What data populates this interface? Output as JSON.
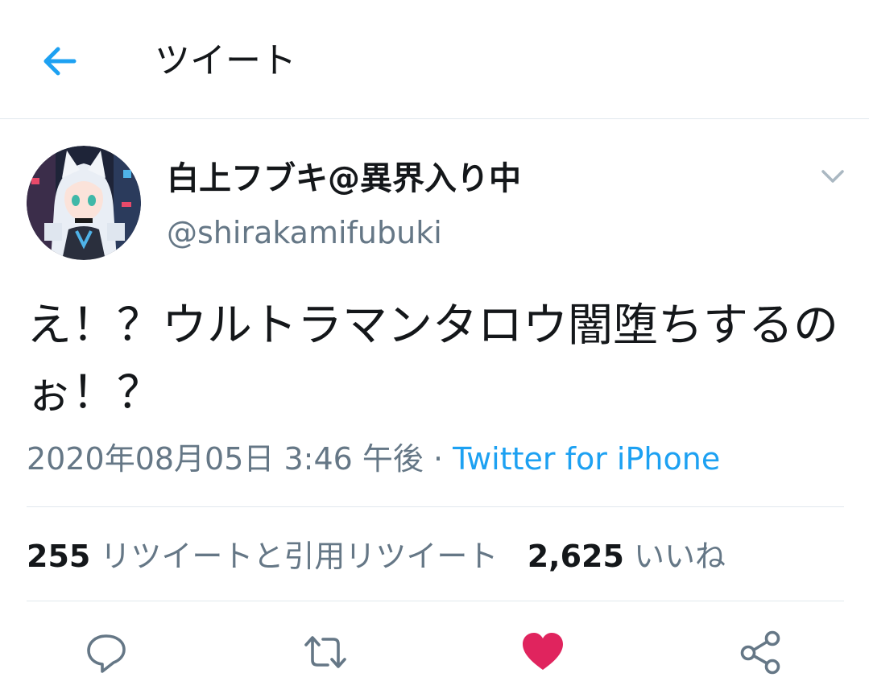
{
  "header": {
    "title": "ツイート",
    "back_icon": "arrow-left-icon"
  },
  "tweet": {
    "author_name": "白上フブキ@異界入り中",
    "author_handle": "@shirakamifubuki",
    "text": "え！？ウルトラマンタロウ闇堕ちするのぉ！？",
    "datetime": "2020年08月05日 3:46 午後",
    "separator": " · ",
    "source": "Twitter for iPhone"
  },
  "stats": {
    "retweets_count": "255",
    "retweets_label": "リツイートと引用リツイート",
    "likes_count": "2,625",
    "likes_label": "いいね"
  },
  "actions": [
    {
      "name": "reply",
      "icon": "reply-icon"
    },
    {
      "name": "retweet",
      "icon": "retweet-icon"
    },
    {
      "name": "like",
      "icon": "heart-icon"
    },
    {
      "name": "share",
      "icon": "share-icon"
    }
  ],
  "colors": {
    "accent": "#1da1f2",
    "muted": "#657786",
    "like": "#e0245e",
    "divider": "#e1e8ed"
  }
}
